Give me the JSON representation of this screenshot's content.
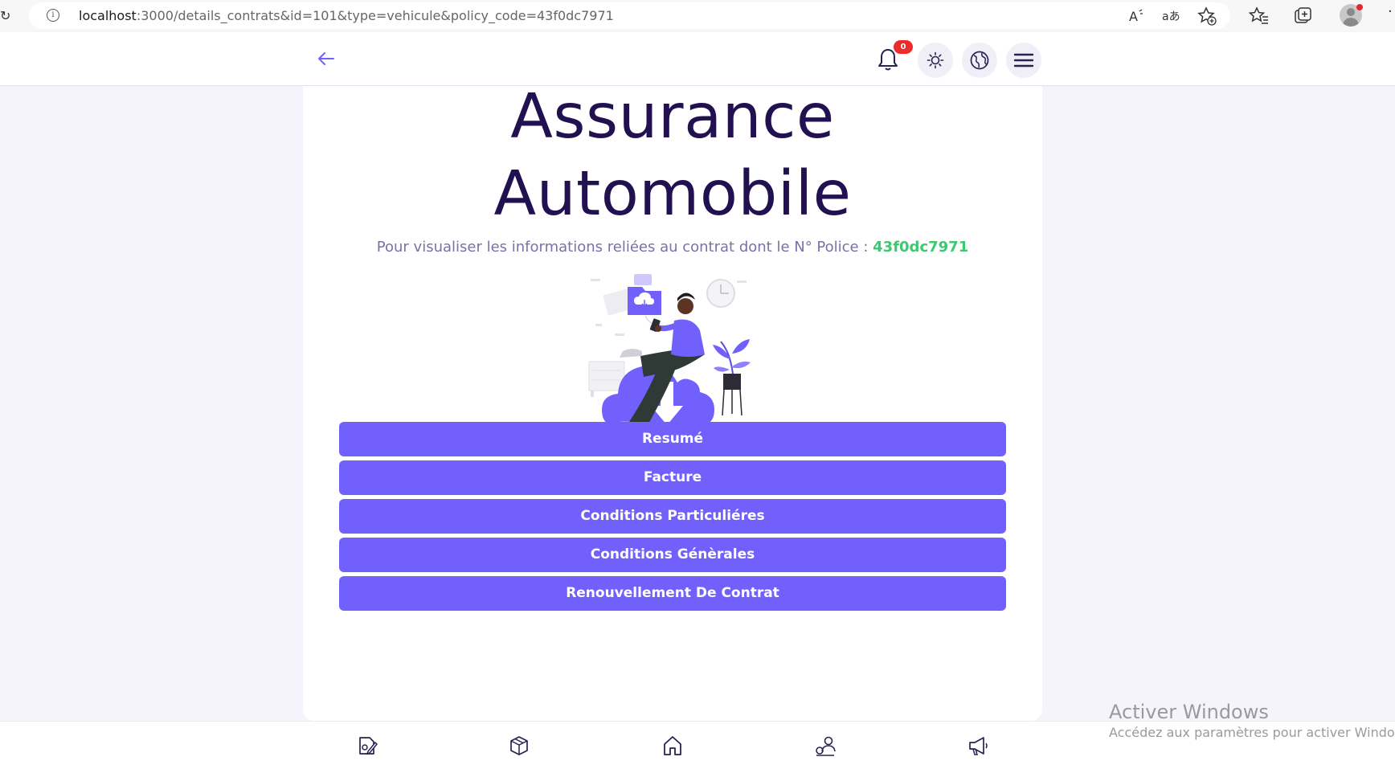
{
  "browser": {
    "reload_icon": "reload-icon",
    "url_host": "localhost",
    "url_rest": ":3000/details_contrats&id=101&type=vehicule&policy_code=43f0dc7971",
    "icons": [
      "read-aloud-icon",
      "translate-icon",
      "add-favorite-icon",
      "favorites-icon",
      "collections-icon",
      "profile-icon",
      "more-icon"
    ]
  },
  "header": {
    "back_icon": "arrow-left-icon",
    "notification_count": "0",
    "icons": [
      "bell-icon",
      "sun-icon",
      "globe-icon",
      "menu-icon"
    ]
  },
  "main": {
    "title_line1": "Assurance",
    "title_line2": "Automobile",
    "subtitle": "Pour visualiser les informations reliées au contrat dont le N° Police :",
    "policy_code": "43f0dc7971",
    "buttons": [
      "Resumé",
      "Facture",
      "Conditions Particuliéres",
      "Conditions Génèrales",
      "Renouvellement De Contrat"
    ]
  },
  "bottom_nav": {
    "items": [
      "contracts-icon",
      "box-icon",
      "home-icon",
      "user-location-icon",
      "megaphone-icon"
    ]
  },
  "watermark": {
    "line1": "Activer Windows",
    "line2": "Accédez aux paramètres pour activer Windows"
  },
  "colors": {
    "primary": "#7160fb",
    "title": "#211150",
    "subtitle": "#7d6fa8",
    "policy_code": "#3cc972",
    "badge": "#ee2b2b",
    "background": "#f5f4fd"
  }
}
